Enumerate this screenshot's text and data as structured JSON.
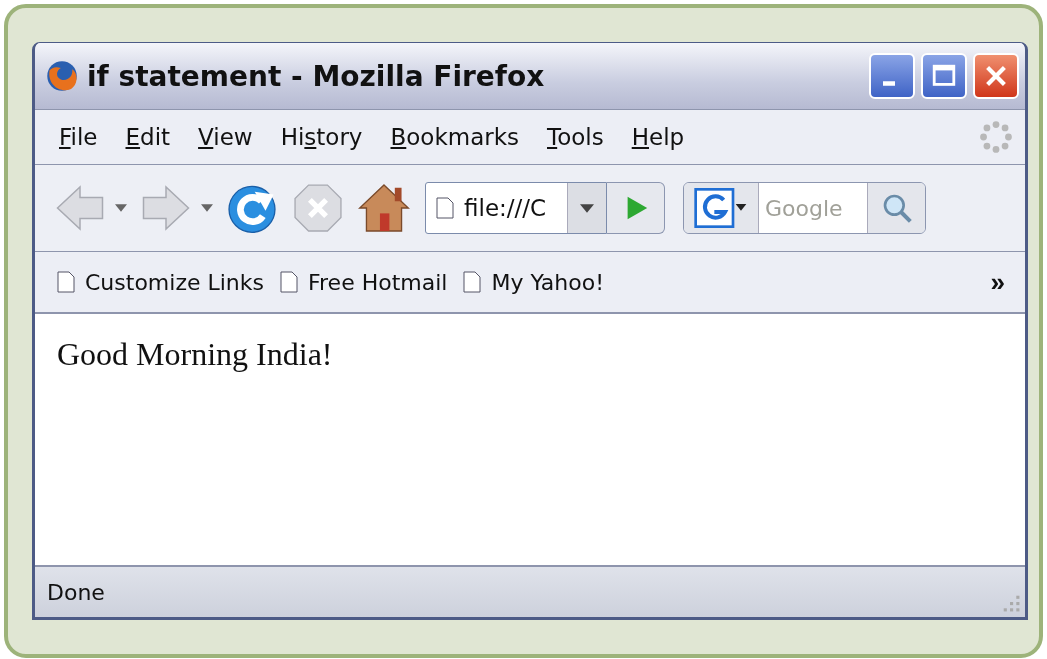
{
  "window": {
    "title": "if statement - Mozilla Firefox"
  },
  "menu": [
    {
      "key": "F",
      "key_after": "ile"
    },
    {
      "key": "E",
      "key_after": "dit"
    },
    {
      "key": "V",
      "key_after": "iew"
    },
    {
      "key_before": "Hi",
      "key": "s",
      "key_after": "tory"
    },
    {
      "key": "B",
      "key_after": "ookmarks"
    },
    {
      "key": "T",
      "key_after": "ools"
    },
    {
      "key": "H",
      "key_after": "elp"
    }
  ],
  "navigation": [
    {
      "kind": "back",
      "disabled": true
    },
    {
      "kind": "forward",
      "disabled": true
    },
    {
      "kind": "reload",
      "disabled": false
    },
    {
      "kind": "stop",
      "disabled": true
    },
    {
      "kind": "home",
      "disabled": false
    }
  ],
  "address": {
    "value": "file:///C"
  },
  "search": {
    "placeholder": "Google"
  },
  "bookmarks": {
    "items": [
      "Customize Links",
      "Free Hotmail",
      "My Yahoo!"
    ],
    "overflow": "»"
  },
  "content": {
    "text": "Good Morning India!"
  },
  "status_bar": {
    "text": "Done"
  }
}
